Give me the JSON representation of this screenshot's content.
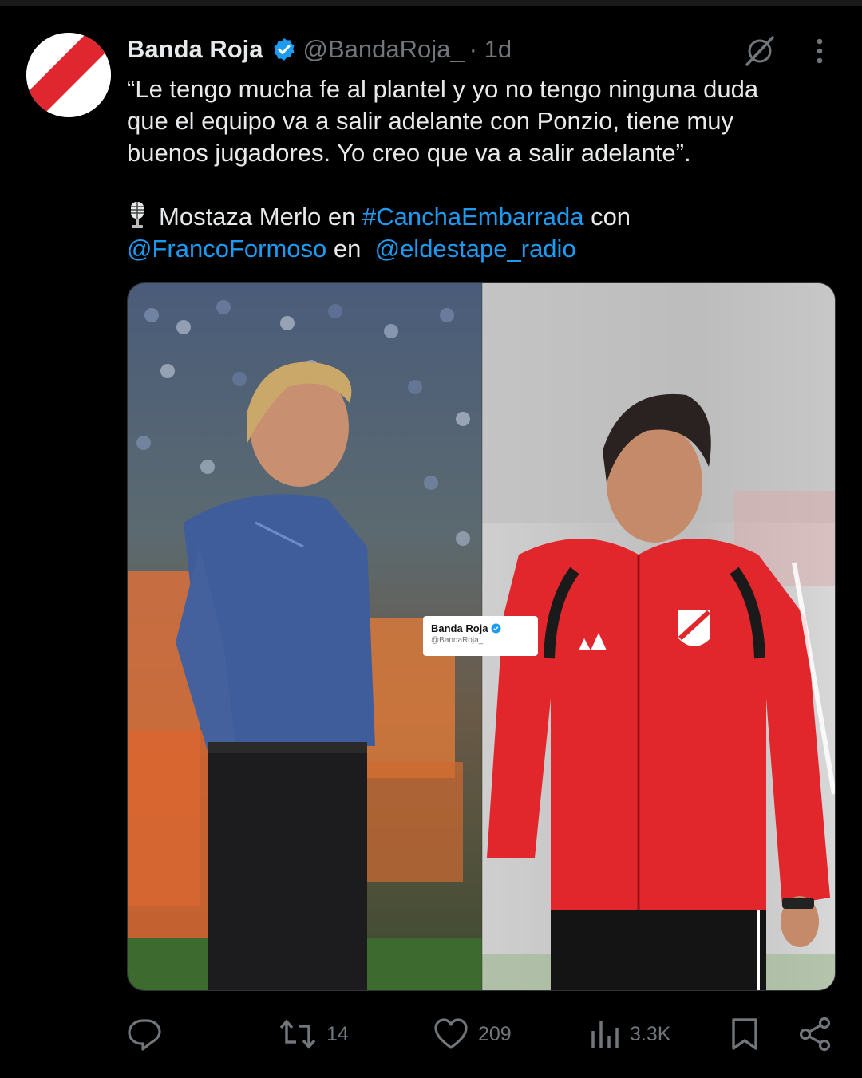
{
  "post": {
    "author": {
      "display_name": "Banda Roja",
      "handle": "@BandaRoja_",
      "time": "· 1d",
      "verified": true
    },
    "text": {
      "line1": "“Le tengo mucha fe al plantel y yo no tengo ninguna duda",
      "line2": "que el equipo va a salir adelante con Ponzio, tiene muy",
      "line3": "buenos jugadores. Yo creo que va a salir adelante”.",
      "credit_prefix": "Mostaza Merlo en ",
      "hashtag": "#CanchaEmbarrada",
      "credit_con": " con",
      "mention1": "@FrancoFormoso",
      "credit_en": " en  ",
      "mention2": "@eldestape_radio"
    },
    "image_watermark": {
      "name": "Banda Roja",
      "handle": "@BandaRoja_"
    },
    "actions": {
      "reply": "",
      "reposts": "14",
      "likes": "209",
      "views": "3.3K"
    }
  },
  "colors": {
    "background": "#000000",
    "text": "#e7e9ea",
    "secondary": "#71767b",
    "link": "#1d9bf0",
    "verified": "#1d9bf0"
  },
  "icons": {
    "mic": "microphone-icon",
    "grok": "grok-icon",
    "more": "more-dots-icon",
    "reply": "reply-icon",
    "repost": "repost-icon",
    "like": "heart-icon",
    "views": "views-chart-icon",
    "bookmark": "bookmark-icon",
    "share": "share-icon"
  }
}
